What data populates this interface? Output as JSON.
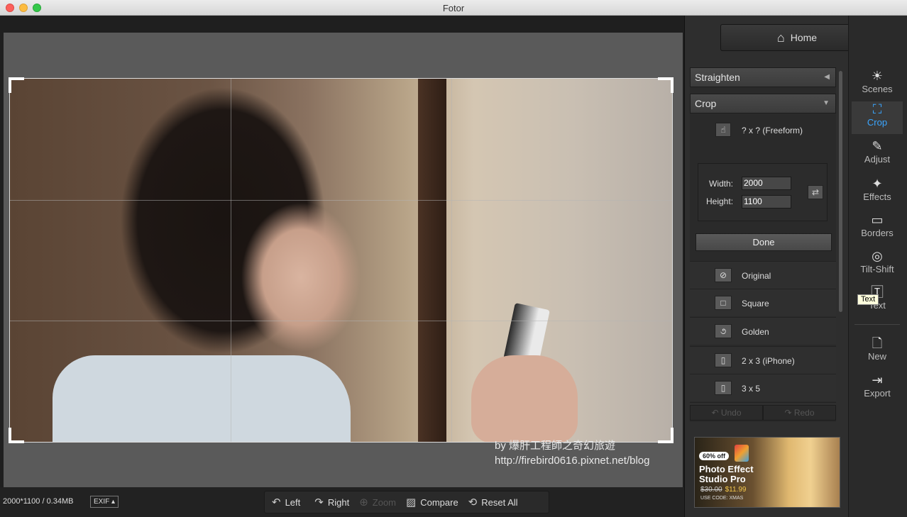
{
  "window": {
    "title": "Fotor"
  },
  "canvas": {
    "watermark_line1": "by 爆肝工程師之奇幻旅遊",
    "watermark_line2": "http://firebird0616.pixnet.net/blog"
  },
  "bottombar": {
    "image_info": "2000*1100 / 0.34MB",
    "exif_label": "EXIF ▴",
    "tools": [
      {
        "label": "Left",
        "icon": "rotate-left-icon"
      },
      {
        "label": "Right",
        "icon": "rotate-right-icon"
      },
      {
        "label": "Zoom",
        "icon": "zoom-icon",
        "disabled": true
      },
      {
        "label": "Compare",
        "icon": "compare-icon"
      },
      {
        "label": "Reset All",
        "icon": "reset-icon"
      }
    ]
  },
  "panel": {
    "home_label": "Home",
    "straighten_label": "Straighten",
    "crop_label": "Crop",
    "freeform_label": "? x ?   (Freeform)",
    "width_label": "Width:",
    "height_label": "Height:",
    "width_value": "2000",
    "height_value": "1100",
    "done_label": "Done",
    "ratios": [
      {
        "label": "Original",
        "icon": "original-icon"
      },
      {
        "label": "Square",
        "icon": "square-icon"
      },
      {
        "label": "Golden",
        "icon": "golden-icon"
      },
      {
        "label": "2 x 3   (iPhone)",
        "icon": "portrait-icon"
      },
      {
        "label": "3 x 5",
        "icon": "portrait-icon"
      }
    ],
    "undo_label": "Undo",
    "redo_label": "Redo"
  },
  "ad": {
    "badge": "60% off",
    "title": "Photo Effect Studio Pro",
    "old_price": "$30.00",
    "price": "$11.99",
    "code": "USE CODE: XMAS"
  },
  "iconbar": {
    "items": [
      {
        "label": "Scenes",
        "icon": "sun-icon"
      },
      {
        "label": "Crop",
        "icon": "crop-icon",
        "active": true
      },
      {
        "label": "Adjust",
        "icon": "pencil-icon"
      },
      {
        "label": "Effects",
        "icon": "sparkle-icon"
      },
      {
        "label": "Borders",
        "icon": "border-icon"
      },
      {
        "label": "Tilt-Shift",
        "icon": "target-icon"
      },
      {
        "label": "Text",
        "icon": "text-icon"
      },
      {
        "label": "New",
        "icon": "new-file-icon"
      },
      {
        "label": "Export",
        "icon": "export-icon"
      }
    ],
    "tooltip": "Text"
  },
  "colors": {
    "accent": "#3aa6ff",
    "panel_bg": "#2e2e2e"
  }
}
